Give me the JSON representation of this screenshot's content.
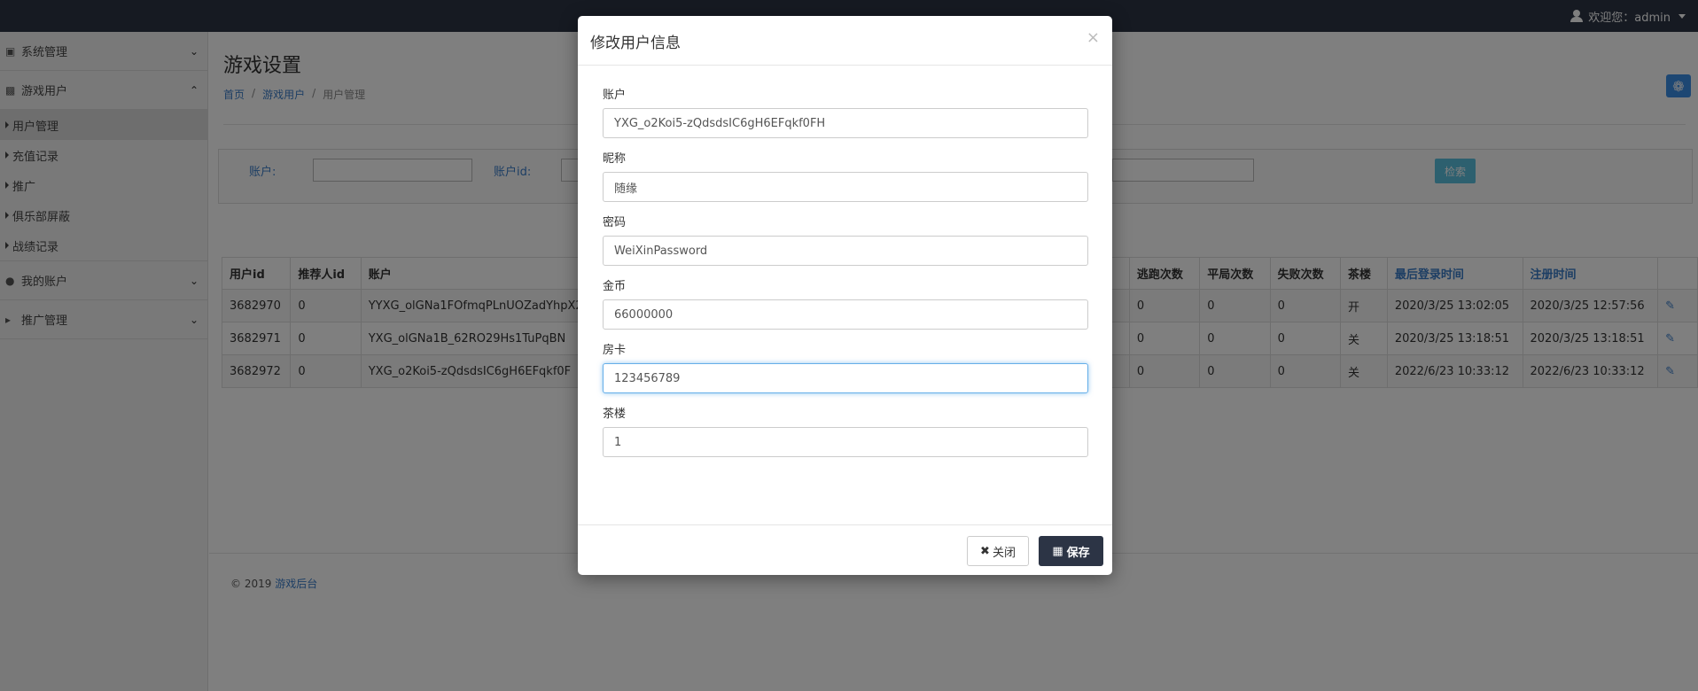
{
  "topbar": {
    "user_text": "欢迎您：admin"
  },
  "sidebar": {
    "groups": [
      {
        "label": "系统管理",
        "icon": "briefcase-icon",
        "chevron": "down"
      },
      {
        "label": "游戏用户",
        "icon": "gamepad-icon",
        "chevron": "up"
      },
      {
        "label": "我的账户",
        "icon": "user-icon",
        "chevron": "down"
      },
      {
        "label": "推广管理",
        "icon": "megaphone-icon",
        "chevron": "down"
      }
    ],
    "game_user_items": [
      "用户管理",
      "充值记录",
      "推广",
      "俱乐部屏蔽",
      "战绩记录"
    ]
  },
  "main": {
    "page_title": "游戏设置",
    "breadcrumb": [
      "首页",
      "游戏用户",
      "用户管理"
    ],
    "filter": {
      "account_label": "账户:",
      "user_id_label": "账户id:",
      "search_button": "检索"
    },
    "table": {
      "headers": [
        "用户id",
        "推荐人id",
        "账户",
        "逃跑次数",
        "平局次数",
        "失败次数",
        "茶楼",
        "最后登录时间",
        "注册时间"
      ],
      "rows": [
        [
          "3682970",
          "0",
          "YYXG_olGNa1FOfmqPLnUOZadYhpX2",
          "0",
          "0",
          "0",
          "开",
          "2020/3/25 13:02:05",
          "2020/3/25 12:57:56"
        ],
        [
          "3682971",
          "0",
          "YXG_olGNa1B_62RO29Hs1TuPqBN",
          "0",
          "0",
          "0",
          "关",
          "2020/3/25 13:18:51",
          "2020/3/25 13:18:51"
        ],
        [
          "3682972",
          "0",
          "YXG_o2Koi5-zQdsdsIC6gH6EFqkf0F",
          "0",
          "0",
          "0",
          "关",
          "2022/6/23 10:33:12",
          "2022/6/23 10:33:12"
        ]
      ]
    },
    "footer": {
      "copyright": "© 2019",
      "link": "游戏后台"
    }
  },
  "modal": {
    "title": "修改用户信息",
    "close_symbol": "×",
    "fields": [
      {
        "label": "账户",
        "value": "YXG_o2Koi5-zQdsdsIC6gH6EFqkf0FH"
      },
      {
        "label": "昵称",
        "value": "随缘"
      },
      {
        "label": "密码",
        "value": "WeiXinPassword"
      },
      {
        "label": "金币",
        "value": "66000000"
      },
      {
        "label": "房卡",
        "value": "123456789"
      },
      {
        "label": "茶楼",
        "value": "1"
      }
    ],
    "close_button": "关闭",
    "save_button": "保存"
  }
}
